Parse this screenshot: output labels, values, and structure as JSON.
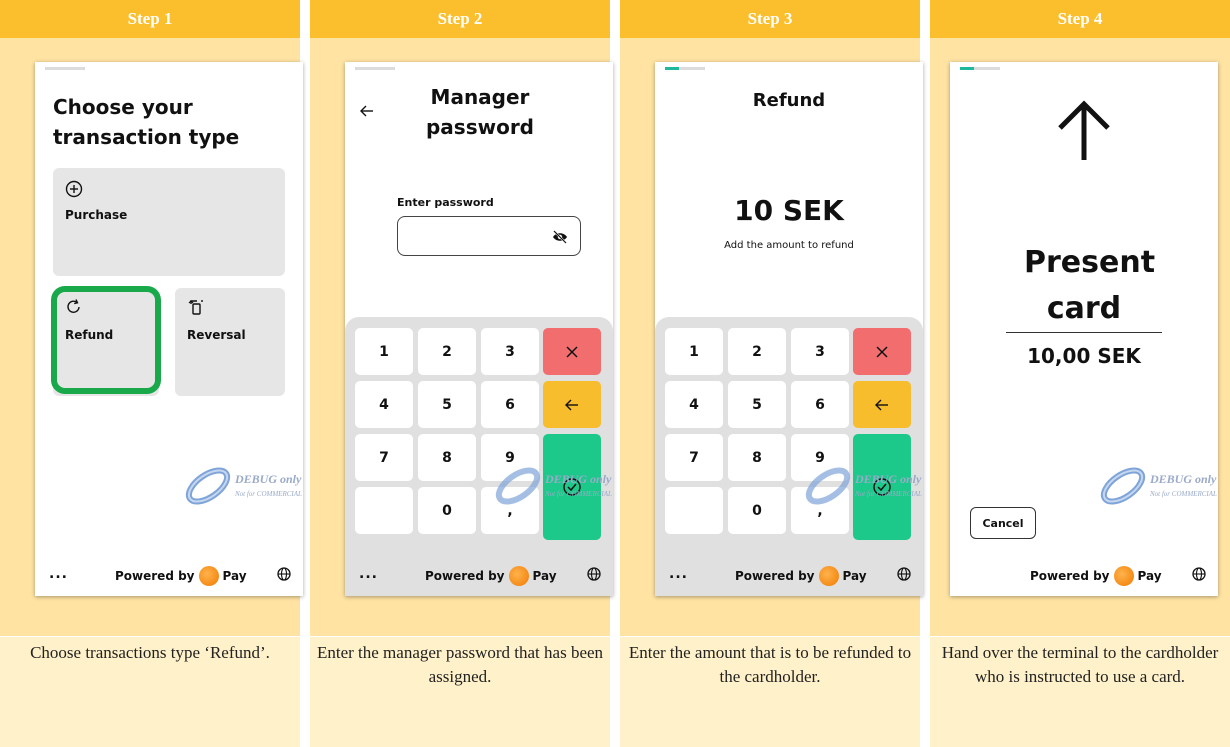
{
  "steps": [
    {
      "header": "Step 1",
      "caption": "Choose transactions type ‘Refund’."
    },
    {
      "header": "Step 2",
      "caption": "Enter the manager password that has been assigned."
    },
    {
      "header": "Step 3",
      "caption": "Enter the amount that is to be refunded to the cardholder."
    },
    {
      "header": "Step 4",
      "caption": "Hand over the terminal to the cardholder who is instructed to use a card."
    }
  ],
  "step1": {
    "title": "Choose your transaction type",
    "tiles": {
      "purchase": "Purchase",
      "refund": "Refund",
      "reversal": "Reversal"
    }
  },
  "step2": {
    "title": "Manager password",
    "password_label": "Enter password",
    "back_icon": "arrow-left-icon"
  },
  "step3": {
    "title": "Refund",
    "amount": "10 SEK",
    "subtitle": "Add the amount to refund"
  },
  "step4": {
    "title": "Present card",
    "amount": "10,00 SEK",
    "cancel": "Cancel"
  },
  "keypad": {
    "keys": [
      "1",
      "2",
      "3",
      "4",
      "5",
      "6",
      "7",
      "8",
      "9",
      "0",
      ","
    ]
  },
  "footer": {
    "more": "...",
    "powered_by": "Powered by",
    "pay": "Pay"
  },
  "watermark": {
    "line1": "DEBUG only",
    "line2": "Not for COMMERCIAL"
  },
  "colors": {
    "header": "#fbbf2e",
    "body": "#ffe3a3",
    "caption": "#fff1c9",
    "highlight": "#19a84a",
    "key_cancel": "#f26d6d",
    "key_back": "#f8bd2c",
    "key_ok": "#1cc88a"
  }
}
